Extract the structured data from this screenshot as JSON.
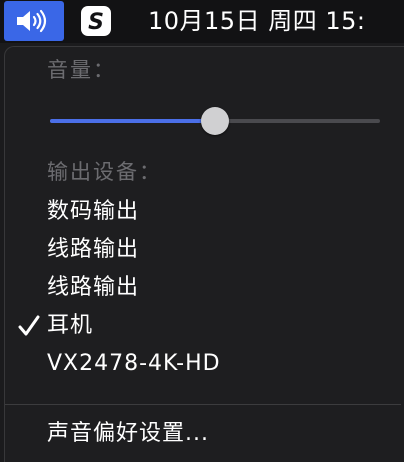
{
  "menubar": {
    "volume_icon": "speaker-volume-icon",
    "input_method_icon": "sogou-input-icon",
    "input_method_glyph": "S",
    "clock": "10月15日 周四  15:"
  },
  "volume_menu": {
    "volume_label": "音量：",
    "volume_level": 0.5,
    "output_label": "输出设备：",
    "devices": [
      {
        "label": "数码输出",
        "selected": false
      },
      {
        "label": "线路输出",
        "selected": false
      },
      {
        "label": "线路输出",
        "selected": false
      },
      {
        "label": "耳机",
        "selected": true
      },
      {
        "label": "VX2478-4K-HD",
        "selected": false
      }
    ],
    "preferences": "声音偏好设置..."
  },
  "colors": {
    "accent": "#3a67e7",
    "slider_fill": "#4b6fe8",
    "menu_background": "#1e1e20",
    "menubar_background": "#121214"
  }
}
